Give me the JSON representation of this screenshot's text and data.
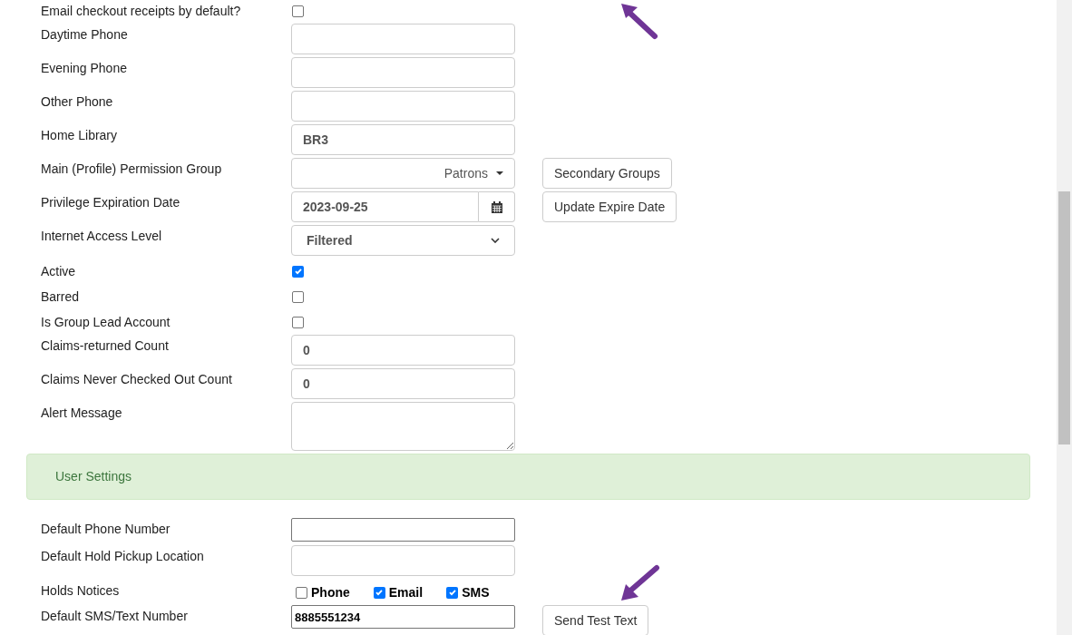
{
  "fields": [
    {
      "kind": "checkbox",
      "label": "Email checkout receipts by default?",
      "checked": false
    },
    {
      "kind": "text",
      "label": "Daytime Phone"
    },
    {
      "kind": "text",
      "label": "Evening Phone"
    },
    {
      "kind": "text",
      "label": "Other Phone"
    },
    {
      "kind": "text",
      "label": "Home Library",
      "value": "BR3"
    },
    {
      "kind": "dropdown",
      "label": "Main (Profile) Permission Group",
      "value": "Patrons",
      "button": "Secondary Groups"
    },
    {
      "kind": "date",
      "label": "Privilege Expiration Date",
      "value": "2023-09-25",
      "button": "Update Expire Date"
    },
    {
      "kind": "select",
      "label": "Internet Access Level",
      "value": "Filtered"
    },
    {
      "kind": "checkbox",
      "label": "Active",
      "checked": true
    },
    {
      "kind": "checkbox",
      "label": "Barred",
      "checked": false
    },
    {
      "kind": "checkbox",
      "label": "Is Group Lead Account",
      "checked": false
    },
    {
      "kind": "text",
      "label": "Claims-returned Count",
      "value": "0"
    },
    {
      "kind": "text",
      "label": "Claims Never Checked Out Count",
      "value": "0"
    },
    {
      "kind": "textarea",
      "label": "Alert Message"
    }
  ],
  "settings_panel": {
    "title": "User Settings"
  },
  "settings": [
    {
      "kind": "plain",
      "label": "Default Phone Number"
    },
    {
      "kind": "text",
      "label": "Default Hold Pickup Location"
    },
    {
      "kind": "checkgroup",
      "label": "Holds Notices",
      "options": [
        {
          "label": "Phone",
          "checked": false
        },
        {
          "label": "Email",
          "checked": true
        },
        {
          "label": "SMS",
          "checked": true
        }
      ]
    },
    {
      "kind": "plain",
      "label": "Default SMS/Text Number",
      "value": "8885551234",
      "button": "Send Test Text"
    }
  ]
}
